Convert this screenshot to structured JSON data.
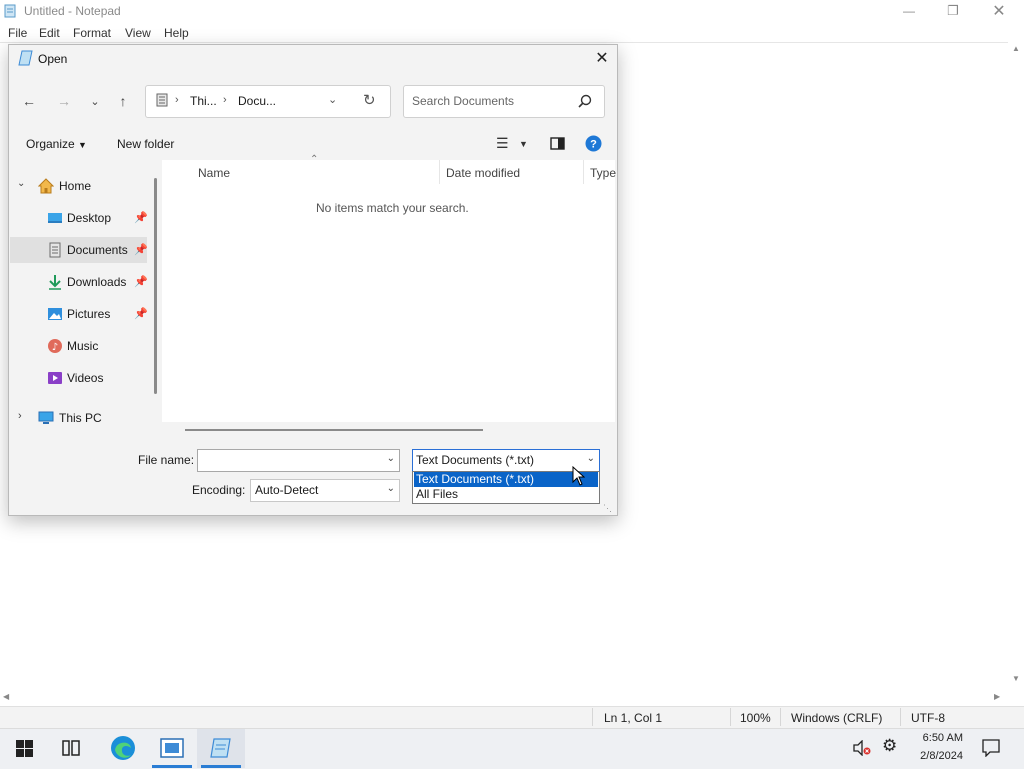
{
  "notepad": {
    "title": "Untitled - Notepad",
    "menu": [
      "File",
      "Edit",
      "Format",
      "View",
      "Help"
    ]
  },
  "statusbar": {
    "position": "Ln 1, Col 1",
    "zoom": "100%",
    "line_ending": "Windows (CRLF)",
    "encoding": "UTF-8"
  },
  "dialog": {
    "title": "Open",
    "breadcrumb": [
      "Thi...",
      "Docu..."
    ],
    "search_placeholder": "Search Documents",
    "organize": "Organize",
    "new_folder": "New folder",
    "nav_items": [
      {
        "label": "Home",
        "pinned": false
      },
      {
        "label": "Desktop",
        "pinned": true
      },
      {
        "label": "Documents",
        "pinned": true
      },
      {
        "label": "Downloads",
        "pinned": true
      },
      {
        "label": "Pictures",
        "pinned": true
      },
      {
        "label": "Music",
        "pinned": false
      },
      {
        "label": "Videos",
        "pinned": false
      },
      {
        "label": "This PC",
        "pinned": false
      }
    ],
    "columns": [
      "Name",
      "Date modified",
      "Type"
    ],
    "empty_message": "No items match your search.",
    "file_name_label": "File name:",
    "file_name_value": "",
    "encoding_label": "Encoding:",
    "encoding_value": "Auto-Detect",
    "filetype_value": "Text Documents (*.txt)",
    "filetype_options": [
      "Text Documents (*.txt)",
      "All Files"
    ]
  },
  "taskbar": {
    "time": "6:50 AM",
    "date": "2/8/2024"
  },
  "colors": {
    "accent": "#0a64c8",
    "dialog_bg": "#f3f3f3",
    "selected_nav": "#e0e0e0"
  }
}
